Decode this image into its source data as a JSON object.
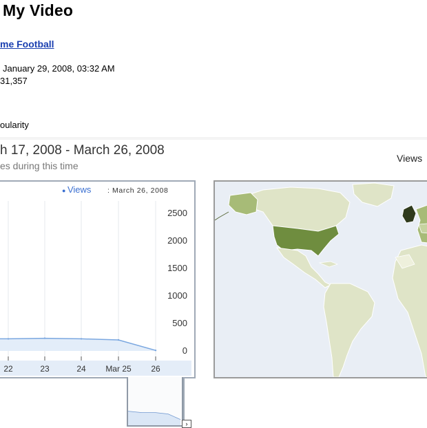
{
  "header": {
    "title": "My Video",
    "video_link": "me Football",
    "date_added": "January 29, 2008, 03:32 AM",
    "views_count": "31,357",
    "section_label": "oularity"
  },
  "stats": {
    "date_range": "h 17, 2008 - March 26, 2008",
    "subtitle": "es during this time",
    "map_label": "Views"
  },
  "legend": {
    "series": "Views",
    "date": ": March 26, 2008"
  },
  "chart_data": {
    "type": "area",
    "categories": [
      "22",
      "23",
      "24",
      "Mar 25",
      "26"
    ],
    "series": [
      {
        "name": "Views",
        "values": [
          220,
          230,
          220,
          200,
          10
        ]
      }
    ],
    "y_ticks": [
      "2500",
      "2000",
      "1500",
      "1000",
      "500",
      "0"
    ],
    "ylim": [
      0,
      2500
    ],
    "grid": "vertical",
    "color": "#7aa7e0"
  },
  "map": {
    "highlight_color": "#6f8d3f",
    "mid_color": "#a7bb77",
    "light_color": "#dfe4c7",
    "ocean_color": "#e9eef5"
  }
}
